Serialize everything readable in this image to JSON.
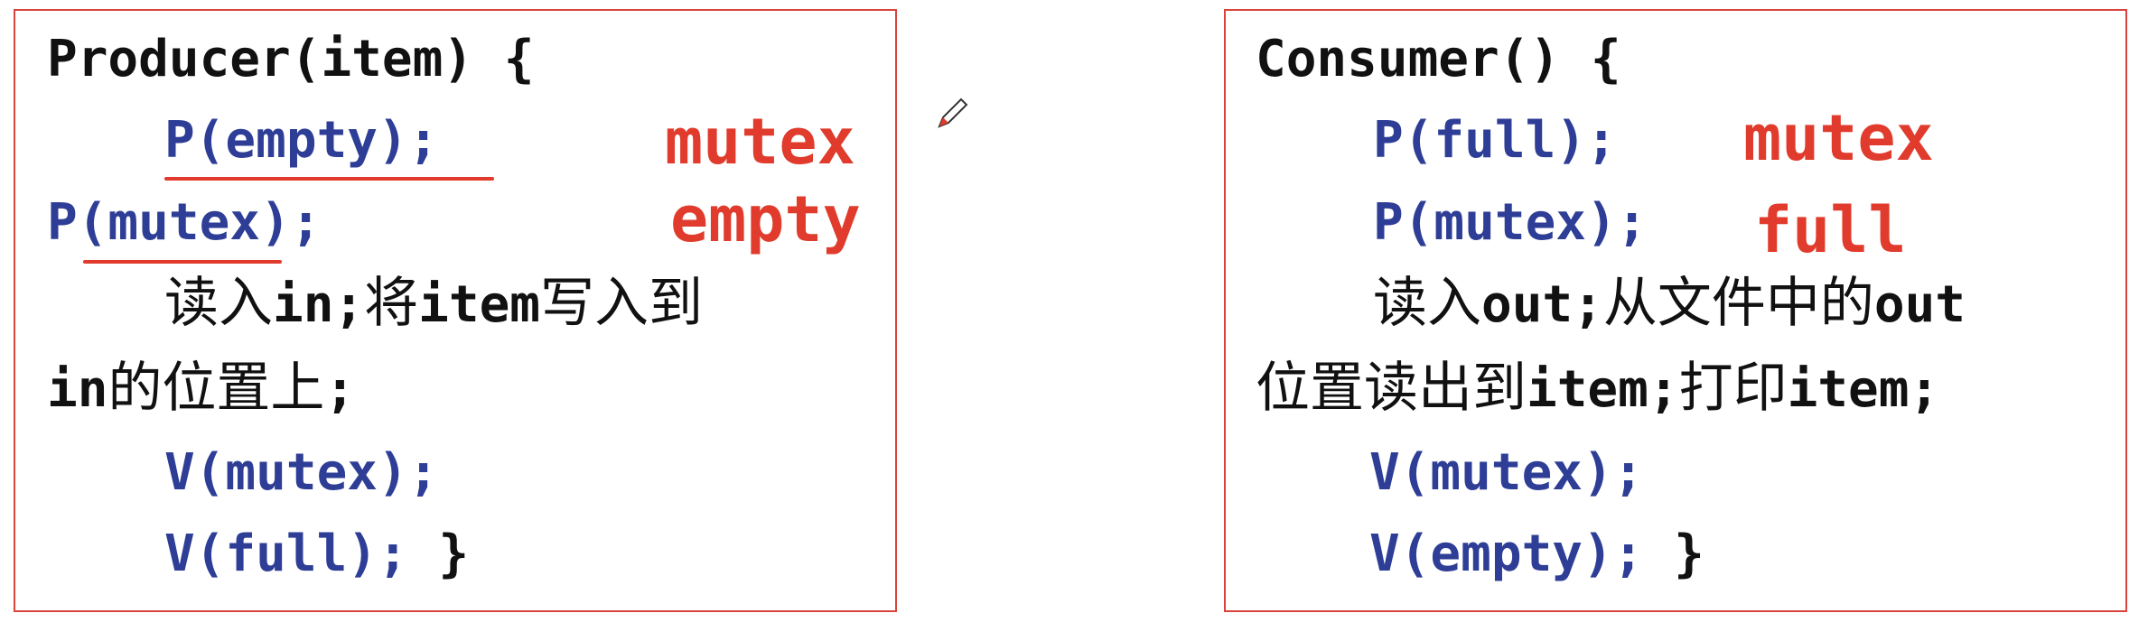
{
  "producer": {
    "header": "Producer(item)  {",
    "line1": "P(empty);",
    "line2": "P(mutex);",
    "line3_cjk1": "读入",
    "line3_code1": "in;",
    "line3_cjk2": "将",
    "line3_code2": "item",
    "line3_cjk3": "写入到",
    "line4_code": "in",
    "line4_cjk": "的位置上",
    "line4_end": ";",
    "line5": "V(mutex);",
    "line6": "V(full);",
    "line6_close": " }",
    "annotation1": "mutex",
    "annotation2": "empty"
  },
  "consumer": {
    "header": "Consumer()  {",
    "line1": "P(full);",
    "line2": "P(mutex);",
    "line3_cjk1": "读入",
    "line3_code1": "out;",
    "line3_cjk2": "从文件中的",
    "line3_code2": "out",
    "line4_cjk1": "位置读出到",
    "line4_code1": "item;",
    "line4_cjk2": "打印",
    "line4_code2": "item;",
    "line5": "V(mutex);",
    "line6": "V(empty);",
    "line6_close": " }",
    "annotation1": "mutex",
    "annotation2": "full"
  },
  "colors": {
    "frame": "#d9443c",
    "code_blue": "#2e3e96",
    "annotation_red": "#e03b2c",
    "text_black": "#111111"
  },
  "icons": [
    "pen-icon"
  ]
}
